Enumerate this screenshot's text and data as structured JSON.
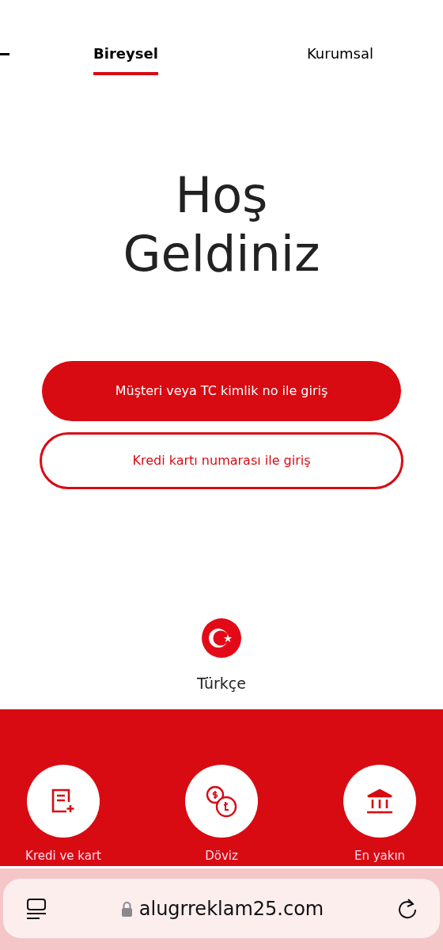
{
  "tabs": [
    {
      "label": "Bireysel",
      "selected": true
    },
    {
      "label": "Kurumsal",
      "selected": false
    }
  ],
  "heading": {
    "line_1": "Hoş",
    "line_2": "Geldiniz"
  },
  "login_buttons": [
    {
      "label": "Müşteri veya TC kimlik no ile giriş",
      "kind": "filled"
    },
    {
      "label": "Kredi kartı numarası ile giriş",
      "kind": "outline"
    }
  ],
  "language": {
    "label": "Türkçe"
  },
  "quick_links": [
    {
      "label": "Kredi ve kart",
      "kind": "document"
    },
    {
      "label": "Döviz",
      "kind": "currency"
    },
    {
      "label": "En yakın",
      "kind": "bank"
    }
  ],
  "browser_bar": {
    "url": "alugrreklam25.com"
  }
}
